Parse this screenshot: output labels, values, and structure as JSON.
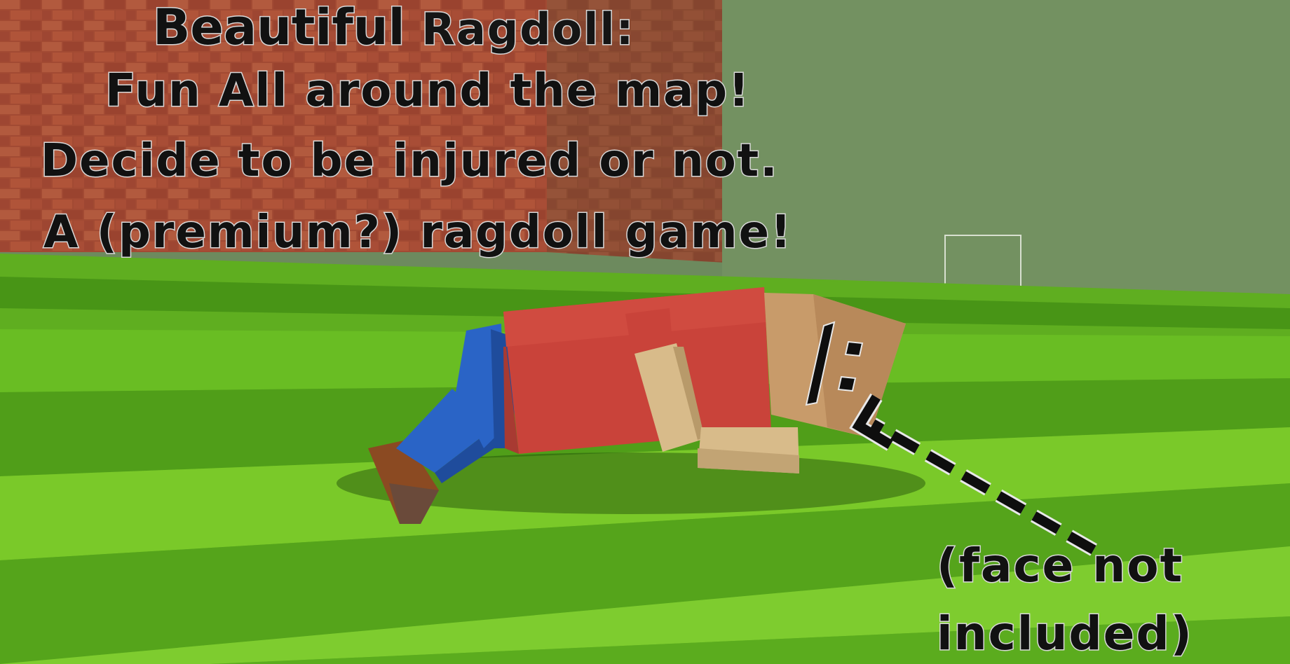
{
  "caption": {
    "title_word_1": "Beautiful",
    "title_word_2": "Ragdoll:",
    "line_1": "Fun All around the map!",
    "line_2": "Decide to be injured or not.",
    "line_3": "A (premium?) ragdoll game!"
  },
  "annotation": {
    "face_glyph": "|:",
    "note_line_1": "(face not",
    "note_line_2": "included)",
    "arrow_icon": "dashed-arrow-icon"
  },
  "colors": {
    "grass_light": "#7ecb2a",
    "grass_dark": "#4f9a1a",
    "brick": "#a24a33",
    "wall": "#6e8c5c",
    "torso": "#c9433a",
    "legs": "#2a64c6",
    "skin": "#d8bb8a",
    "head": "#c89b6a",
    "shoe": "#8b4a22"
  }
}
